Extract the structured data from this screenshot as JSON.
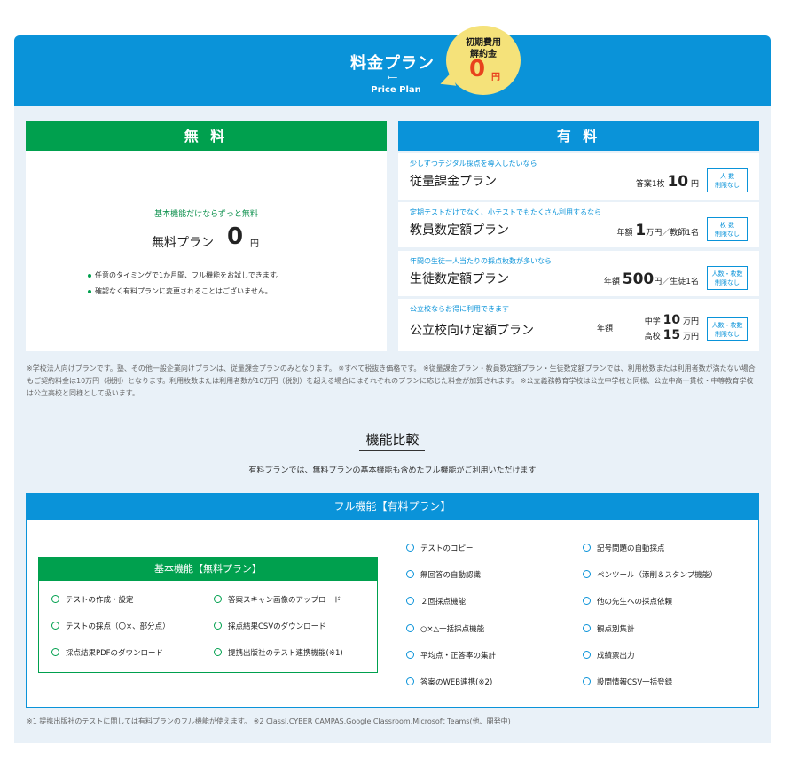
{
  "header": {
    "title": "料金プラン",
    "arrow": "⟵",
    "subtitle": "Price Plan",
    "badge": {
      "line1": "初期費用",
      "line2": "解約金",
      "zero": "0",
      "yen": "円"
    }
  },
  "free": {
    "heading": "無 料",
    "tagline": "基本機能だけならずっと無料",
    "plan_name": "無料プラン",
    "price": "0",
    "yen": "円",
    "notes": [
      "任意のタイミングで1か月間、フル機能をお試しできます。",
      "確認なく有料プランに変更されることはございません。"
    ]
  },
  "paid": {
    "heading": "有 料",
    "plans": [
      {
        "tag": "少しずつデジタル採点を導入したいなら",
        "name": "従量課金プラン",
        "pre": "答案1枚",
        "num": "10",
        "post": "円",
        "badge1": "人 数",
        "badge2": "制限なし"
      },
      {
        "tag": "定期テストだけでなく、小テストでもたくさん利用するなら",
        "name": "教員数定額プラン",
        "pre": "年額",
        "num": "1",
        "post": "万円／教師1名",
        "badge1": "枚 数",
        "badge2": "制限なし"
      },
      {
        "tag": "年間の生徒一人当たりの採点枚数が多いなら",
        "name": "生徒数定額プラン",
        "pre": "年額",
        "num": "500",
        "post": "円／生徒1名",
        "badge1": "人数・枚数",
        "badge2": "制限なし"
      },
      {
        "tag": "公立校ならお得に利用できます",
        "name": "公立校向け定額プラン",
        "pre": "年額",
        "line1_pre": "中学",
        "line1_num": "10",
        "line1_post": "万円",
        "line2_pre": "高校",
        "line2_num": "15",
        "line2_post": "万円",
        "badge1": "人数・枚数",
        "badge2": "制限なし"
      }
    ]
  },
  "disclaimer": "※学校法人向けプランです。塾、その他一般企業向けプランは、従量課金プランのみとなります。 ※すべて税抜き価格です。 ※従量課金プラン・教員数定額プラン・生徒数定額プランでは、利用枚数または利用者数が満たない場合もご契約料金は10万円（税別）となります。利用枚数または利用者数が10万円（税別）を超える場合にはそれぞれのプランに応じた料金が加算されます。 ※公立義務教育学校は公立中学校と同様、公立中高一貫校・中等教育学校は公立高校と同様として扱います。",
  "compare": {
    "title": "機能比較",
    "subtitle": "有料プランでは、無料プランの基本機能も含めたフル機能がご利用いただけます",
    "full_heading": "フル機能【有料プラン】",
    "basic_heading": "基本機能【無料プラン】",
    "basic_features": [
      "テストの作成・設定",
      "答案スキャン画像のアップロード",
      "テストの採点（〇×、部分点）",
      "採点結果CSVのダウンロード",
      "採点結果PDFのダウンロード",
      "提携出版社のテスト連携機能(※1)"
    ],
    "full_features": [
      "テストのコピー",
      "記号問題の自動採点",
      "無回答の自動認識",
      "ペンツール（添削＆スタンプ機能）",
      "２回採点機能",
      "他の先生への採点依頼",
      "○×△一括採点機能",
      "観点別集計",
      "平均点・正答率の集計",
      "成績票出力",
      "答案のWEB連携(※2)",
      "設問情報CSV一括登録"
    ]
  },
  "footnote": "※1 提携出版社のテストに関しては有料プランのフル機能が使えます。 ※2 Classi,CYBER CAMPAS,Google Classroom,Microsoft Teams(他、開発中)"
}
